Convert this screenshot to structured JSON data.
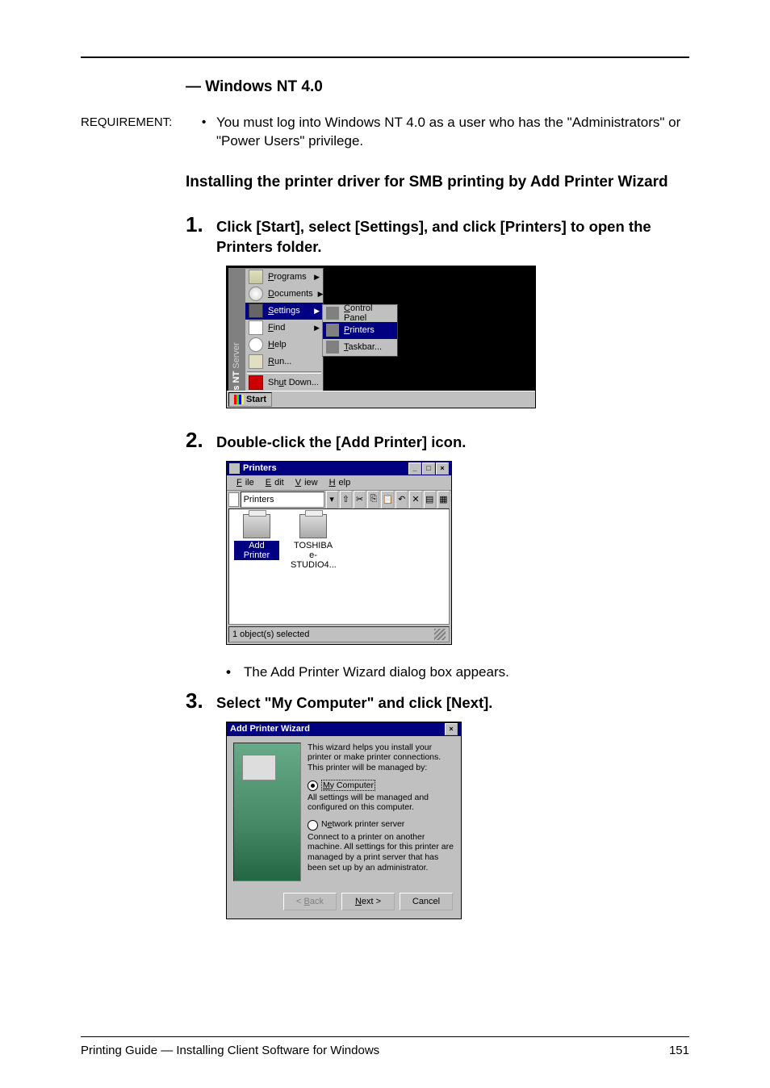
{
  "heading_os": "— Windows NT 4.0",
  "requirement_label": "REQUIREMENT:",
  "requirement_text": "You must log into Windows NT 4.0 as a user who has the \"Administrators\" or \"Power Users\" privilege.",
  "heading_task": "Installing the printer driver for SMB printing by Add Printer Wizard",
  "steps": {
    "s1": {
      "num": "1.",
      "text": "Click [Start], select [Settings], and click [Printers] to open the Printers folder."
    },
    "s2": {
      "num": "2.",
      "text": "Double-click the [Add Printer] icon."
    },
    "s2_note": "The Add Printer Wizard dialog box appears.",
    "s3": {
      "num": "3.",
      "text": "Select \"My Computer\" and click [Next]."
    }
  },
  "ss1": {
    "sidebar_a": "Windows NT",
    "sidebar_b": " Server",
    "items": {
      "programs": "Programs",
      "documents": "Documents",
      "settings": "Settings",
      "find": "Find",
      "help": "Help",
      "run": "Run...",
      "shutdown": "Shut Down..."
    },
    "submenu": {
      "control_panel": "Control Panel",
      "printers": "Printers",
      "taskbar": "Taskbar..."
    },
    "start": "Start"
  },
  "ss2": {
    "title": "Printers",
    "menus": {
      "file": "File",
      "edit": "Edit",
      "view": "View",
      "help": "Help"
    },
    "address": "Printers",
    "icons": {
      "add_printer": "Add Printer",
      "toshiba": "TOSHIBA e-STUDIO4..."
    },
    "status": "1 object(s) selected"
  },
  "ss3": {
    "title": "Add Printer Wizard",
    "intro": "This wizard helps you install your printer or make printer connections.  This printer will be managed by:",
    "opt_my_computer": "My Computer",
    "my_computer_desc": "All settings will be managed and configured on this computer.",
    "opt_network": "Network printer server",
    "network_desc": "Connect to a printer on another machine.  All settings for this printer are managed by a print server that has been set up by an administrator.",
    "back": "< Back",
    "next": "Next >",
    "cancel": "Cancel"
  },
  "footer_left": "Printing Guide — Installing Client Software for Windows",
  "footer_right": "151"
}
